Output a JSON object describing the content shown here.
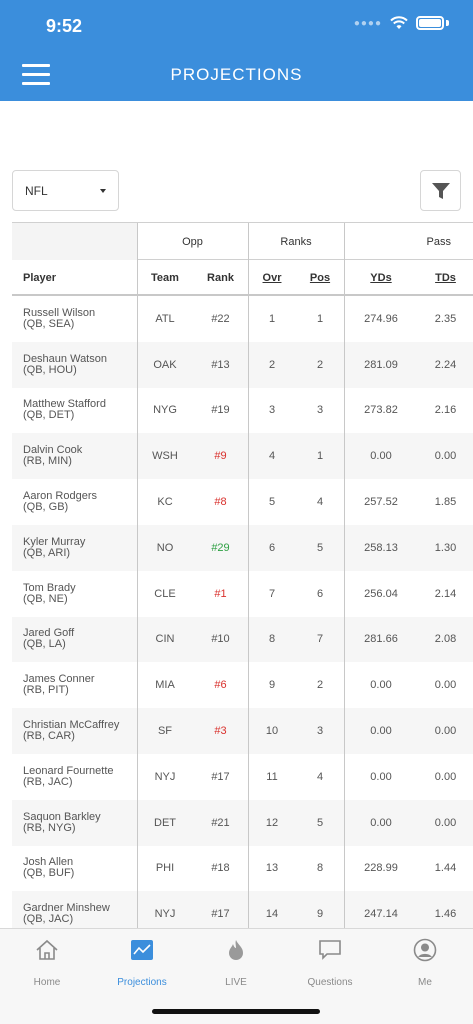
{
  "status": {
    "time": "9:52"
  },
  "header": {
    "title": "PROJECTIONS"
  },
  "league": {
    "selected": "NFL"
  },
  "table": {
    "groups": {
      "opp": "Opp",
      "ranks": "Ranks",
      "pass": "Pass"
    },
    "columns": {
      "player": "Player",
      "team": "Team",
      "rank": "Rank",
      "ovr": "Ovr",
      "pos": "Pos",
      "yds": "YDs",
      "tds": "TDs"
    },
    "rows": [
      {
        "name": "Russell Wilson",
        "meta": "(QB, SEA)",
        "team": "ATL",
        "rank": "#22",
        "rank_color": "normal",
        "ovr": "1",
        "pos": "1",
        "yds": "274.96",
        "tds": "2.35"
      },
      {
        "name": "Deshaun Watson",
        "meta": "(QB, HOU)",
        "team": "OAK",
        "rank": "#13",
        "rank_color": "normal",
        "ovr": "2",
        "pos": "2",
        "yds": "281.09",
        "tds": "2.24"
      },
      {
        "name": "Matthew Stafford",
        "meta": "(QB, DET)",
        "team": "NYG",
        "rank": "#19",
        "rank_color": "normal",
        "ovr": "3",
        "pos": "3",
        "yds": "273.82",
        "tds": "2.16"
      },
      {
        "name": "Dalvin Cook",
        "meta": "(RB, MIN)",
        "team": "WSH",
        "rank": "#9",
        "rank_color": "red",
        "ovr": "4",
        "pos": "1",
        "yds": "0.00",
        "tds": "0.00"
      },
      {
        "name": "Aaron Rodgers",
        "meta": "(QB, GB)",
        "team": "KC",
        "rank": "#8",
        "rank_color": "red",
        "ovr": "5",
        "pos": "4",
        "yds": "257.52",
        "tds": "1.85"
      },
      {
        "name": "Kyler Murray",
        "meta": "(QB, ARI)",
        "team": "NO",
        "rank": "#29",
        "rank_color": "green",
        "ovr": "6",
        "pos": "5",
        "yds": "258.13",
        "tds": "1.30"
      },
      {
        "name": "Tom Brady",
        "meta": "(QB, NE)",
        "team": "CLE",
        "rank": "#1",
        "rank_color": "red",
        "ovr": "7",
        "pos": "6",
        "yds": "256.04",
        "tds": "2.14"
      },
      {
        "name": "Jared Goff",
        "meta": "(QB, LA)",
        "team": "CIN",
        "rank": "#10",
        "rank_color": "normal",
        "ovr": "8",
        "pos": "7",
        "yds": "281.66",
        "tds": "2.08"
      },
      {
        "name": "James Conner",
        "meta": "(RB, PIT)",
        "team": "MIA",
        "rank": "#6",
        "rank_color": "red",
        "ovr": "9",
        "pos": "2",
        "yds": "0.00",
        "tds": "0.00"
      },
      {
        "name": "Christian McCaffrey",
        "meta": "(RB, CAR)",
        "team": "SF",
        "rank": "#3",
        "rank_color": "red",
        "ovr": "10",
        "pos": "3",
        "yds": "0.00",
        "tds": "0.00"
      },
      {
        "name": "Leonard Fournette",
        "meta": "(RB, JAC)",
        "team": "NYJ",
        "rank": "#17",
        "rank_color": "normal",
        "ovr": "11",
        "pos": "4",
        "yds": "0.00",
        "tds": "0.00"
      },
      {
        "name": "Saquon Barkley",
        "meta": "(RB, NYG)",
        "team": "DET",
        "rank": "#21",
        "rank_color": "normal",
        "ovr": "12",
        "pos": "5",
        "yds": "0.00",
        "tds": "0.00"
      },
      {
        "name": "Josh Allen",
        "meta": "(QB, BUF)",
        "team": "PHI",
        "rank": "#18",
        "rank_color": "normal",
        "ovr": "13",
        "pos": "8",
        "yds": "228.99",
        "tds": "1.44"
      },
      {
        "name": "Gardner Minshew",
        "meta": "(QB, JAC)",
        "team": "NYJ",
        "rank": "#17",
        "rank_color": "normal",
        "ovr": "14",
        "pos": "9",
        "yds": "247.14",
        "tds": "1.46"
      }
    ]
  },
  "tabs": [
    {
      "label": "Home",
      "icon": "home-icon",
      "active": false
    },
    {
      "label": "Projections",
      "icon": "chart-icon",
      "active": true
    },
    {
      "label": "LIVE",
      "icon": "flame-icon",
      "active": false
    },
    {
      "label": "Questions",
      "icon": "chat-icon",
      "active": false
    },
    {
      "label": "Me",
      "icon": "user-icon",
      "active": false
    }
  ],
  "colors": {
    "brand": "#3b8edc",
    "rank_red": "#d9312d",
    "rank_green": "#2ea043"
  }
}
